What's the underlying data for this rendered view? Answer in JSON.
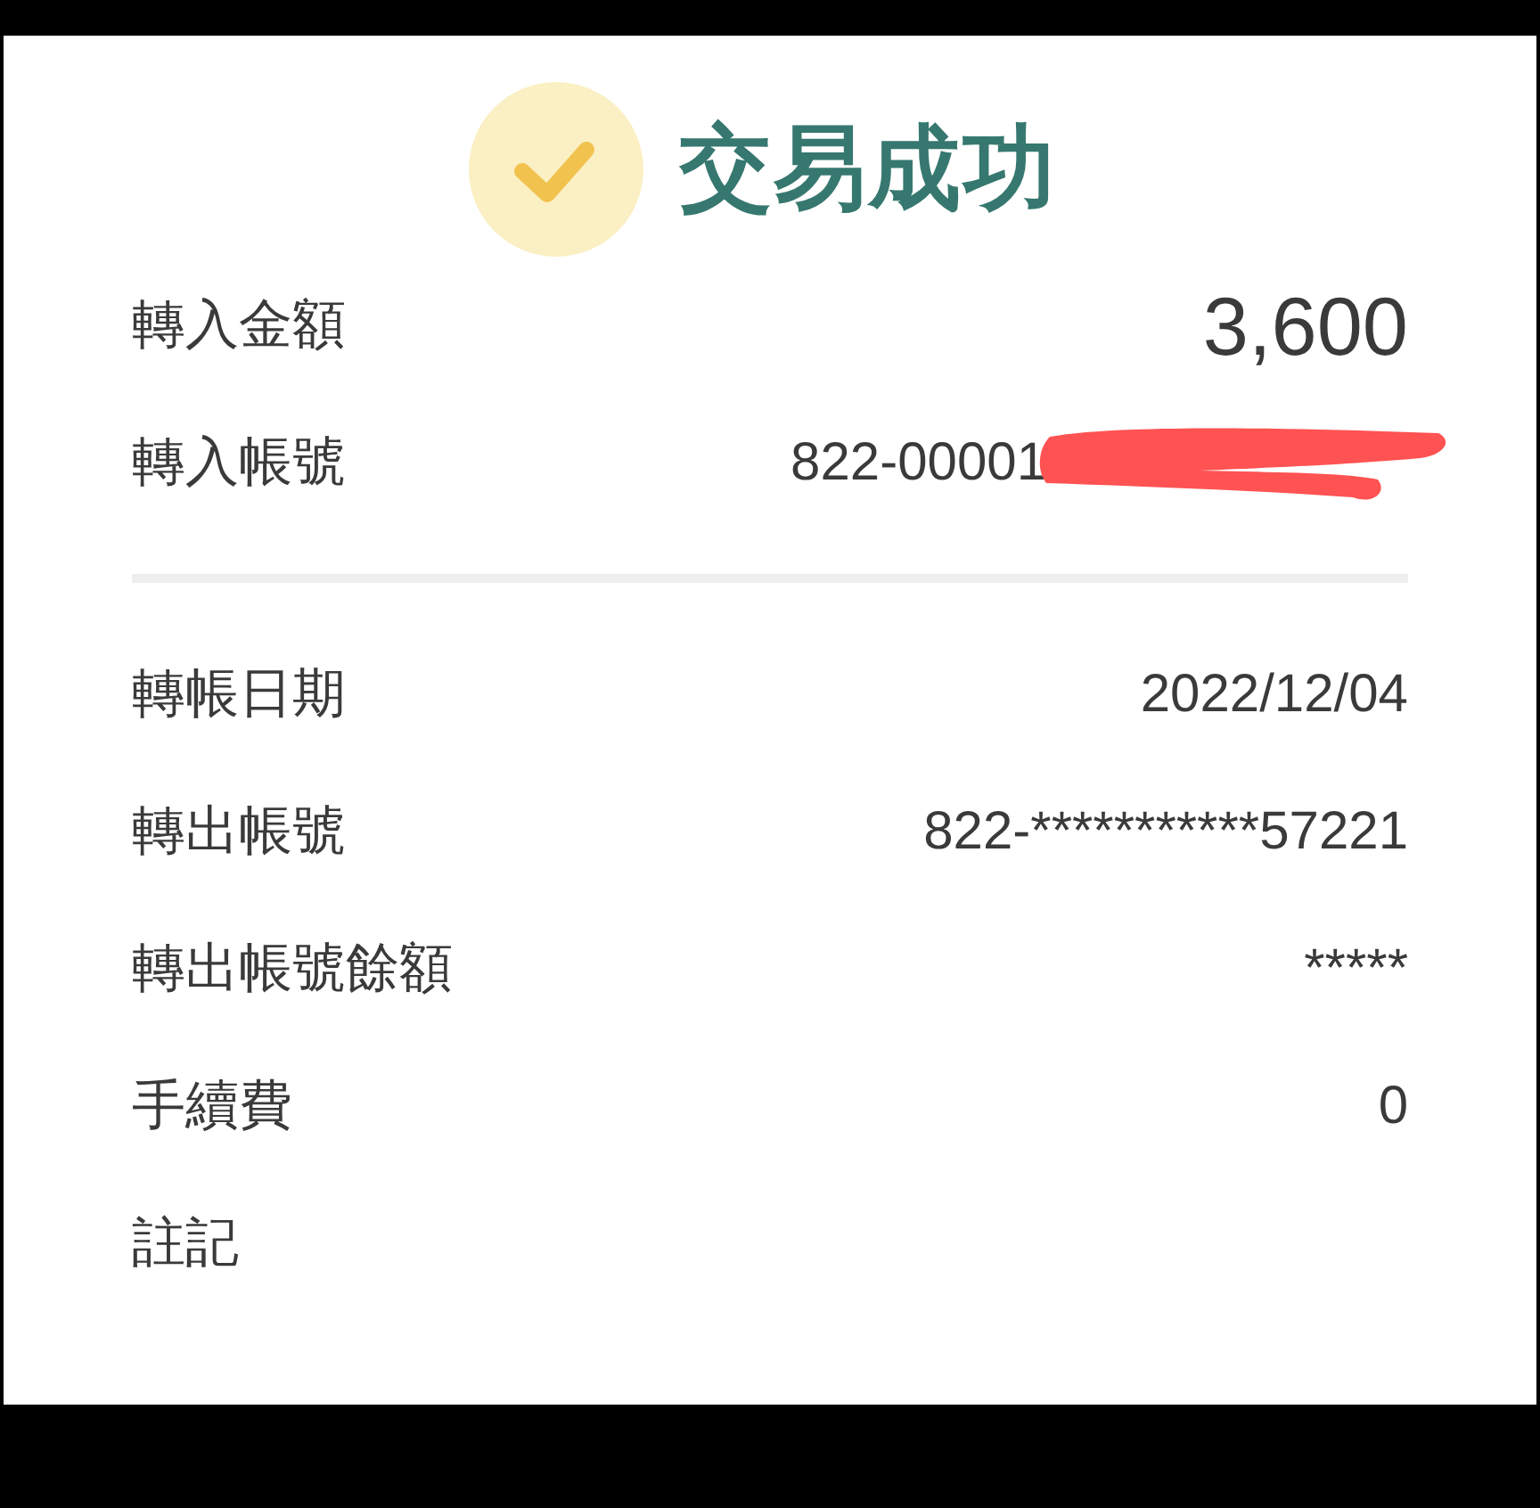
{
  "title": "交易成功",
  "sections": [
    {
      "rows": [
        {
          "label": "轉入金額",
          "value": "3,600",
          "kind": "amount"
        },
        {
          "label": "轉入帳號",
          "value": "822-00001",
          "kind": "redacted"
        }
      ]
    },
    {
      "rows": [
        {
          "label": "轉帳日期",
          "value": "2022/12/04",
          "kind": "plain"
        },
        {
          "label": "轉出帳號",
          "value": "822-***********57221",
          "kind": "plain"
        },
        {
          "label": "轉出帳號餘額",
          "value": "*****",
          "kind": "plain"
        },
        {
          "label": "手續費",
          "value": "0",
          "kind": "plain"
        },
        {
          "label": "註記"
        }
      ]
    }
  ]
}
